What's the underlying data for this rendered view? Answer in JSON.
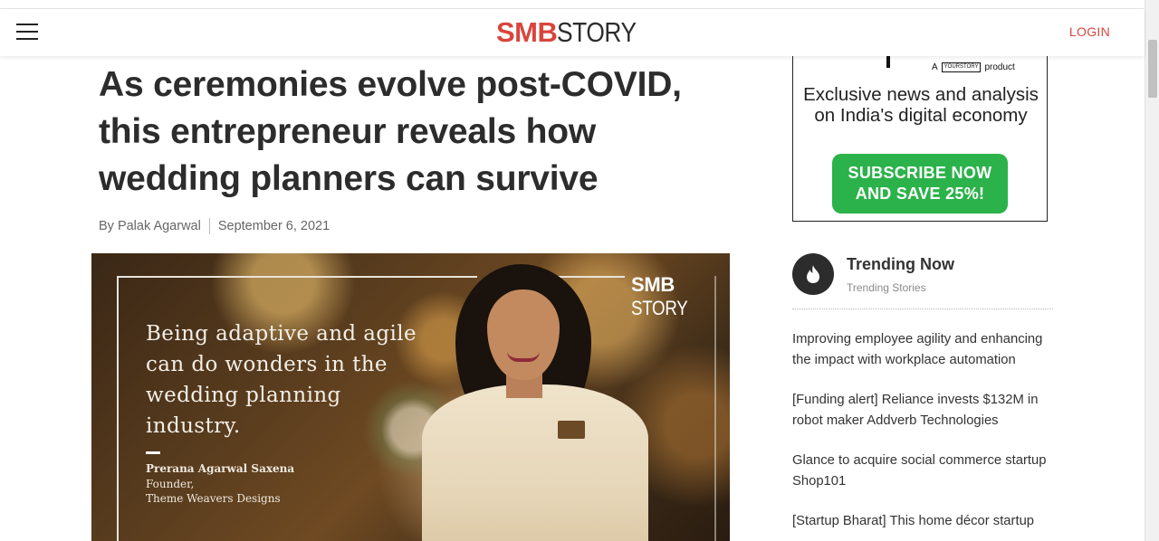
{
  "header": {
    "logo_smb": "SMB",
    "logo_story": "STORY",
    "login_label": "LOGIN"
  },
  "article": {
    "headline": "As ceremonies evolve post-COVID, this entrepreneur reveals how wedding planners can survive",
    "author": "By Palak Agarwal",
    "date": "September 6, 2021",
    "image": {
      "watermark_smb": "SMB",
      "watermark_story": "STORY",
      "quote": "Being adaptive and agile can do wonders in the wedding planning industry.",
      "person_name": "Prerana Agarwal Saxena",
      "person_role": "Founder,",
      "person_company": "Theme Weavers Designs"
    }
  },
  "ad": {
    "a_label": "A",
    "brand_box": "YOURSTORY",
    "product_label": "product",
    "tagline": "Exclusive news and analysis on India's digital economy",
    "cta_line1": "SUBSCRIBE NOW",
    "cta_line2": "AND SAVE 25%!"
  },
  "trending": {
    "title": "Trending Now",
    "subtitle": "Trending Stories",
    "items": [
      "Improving employee agility and enhancing the impact with workplace automation",
      "[Funding alert] Reliance invests $132M in robot maker Addverb Technologies",
      "Glance to acquire social commerce startup Shop101",
      "[Startup Bharat] This home décor startup"
    ]
  },
  "colors": {
    "brand_red": "#d9453d",
    "cta_green": "#2bb24a",
    "text_dark": "#2c2c2c"
  },
  "icons": {
    "menu": "hamburger-menu-icon",
    "trending": "flame-icon"
  }
}
